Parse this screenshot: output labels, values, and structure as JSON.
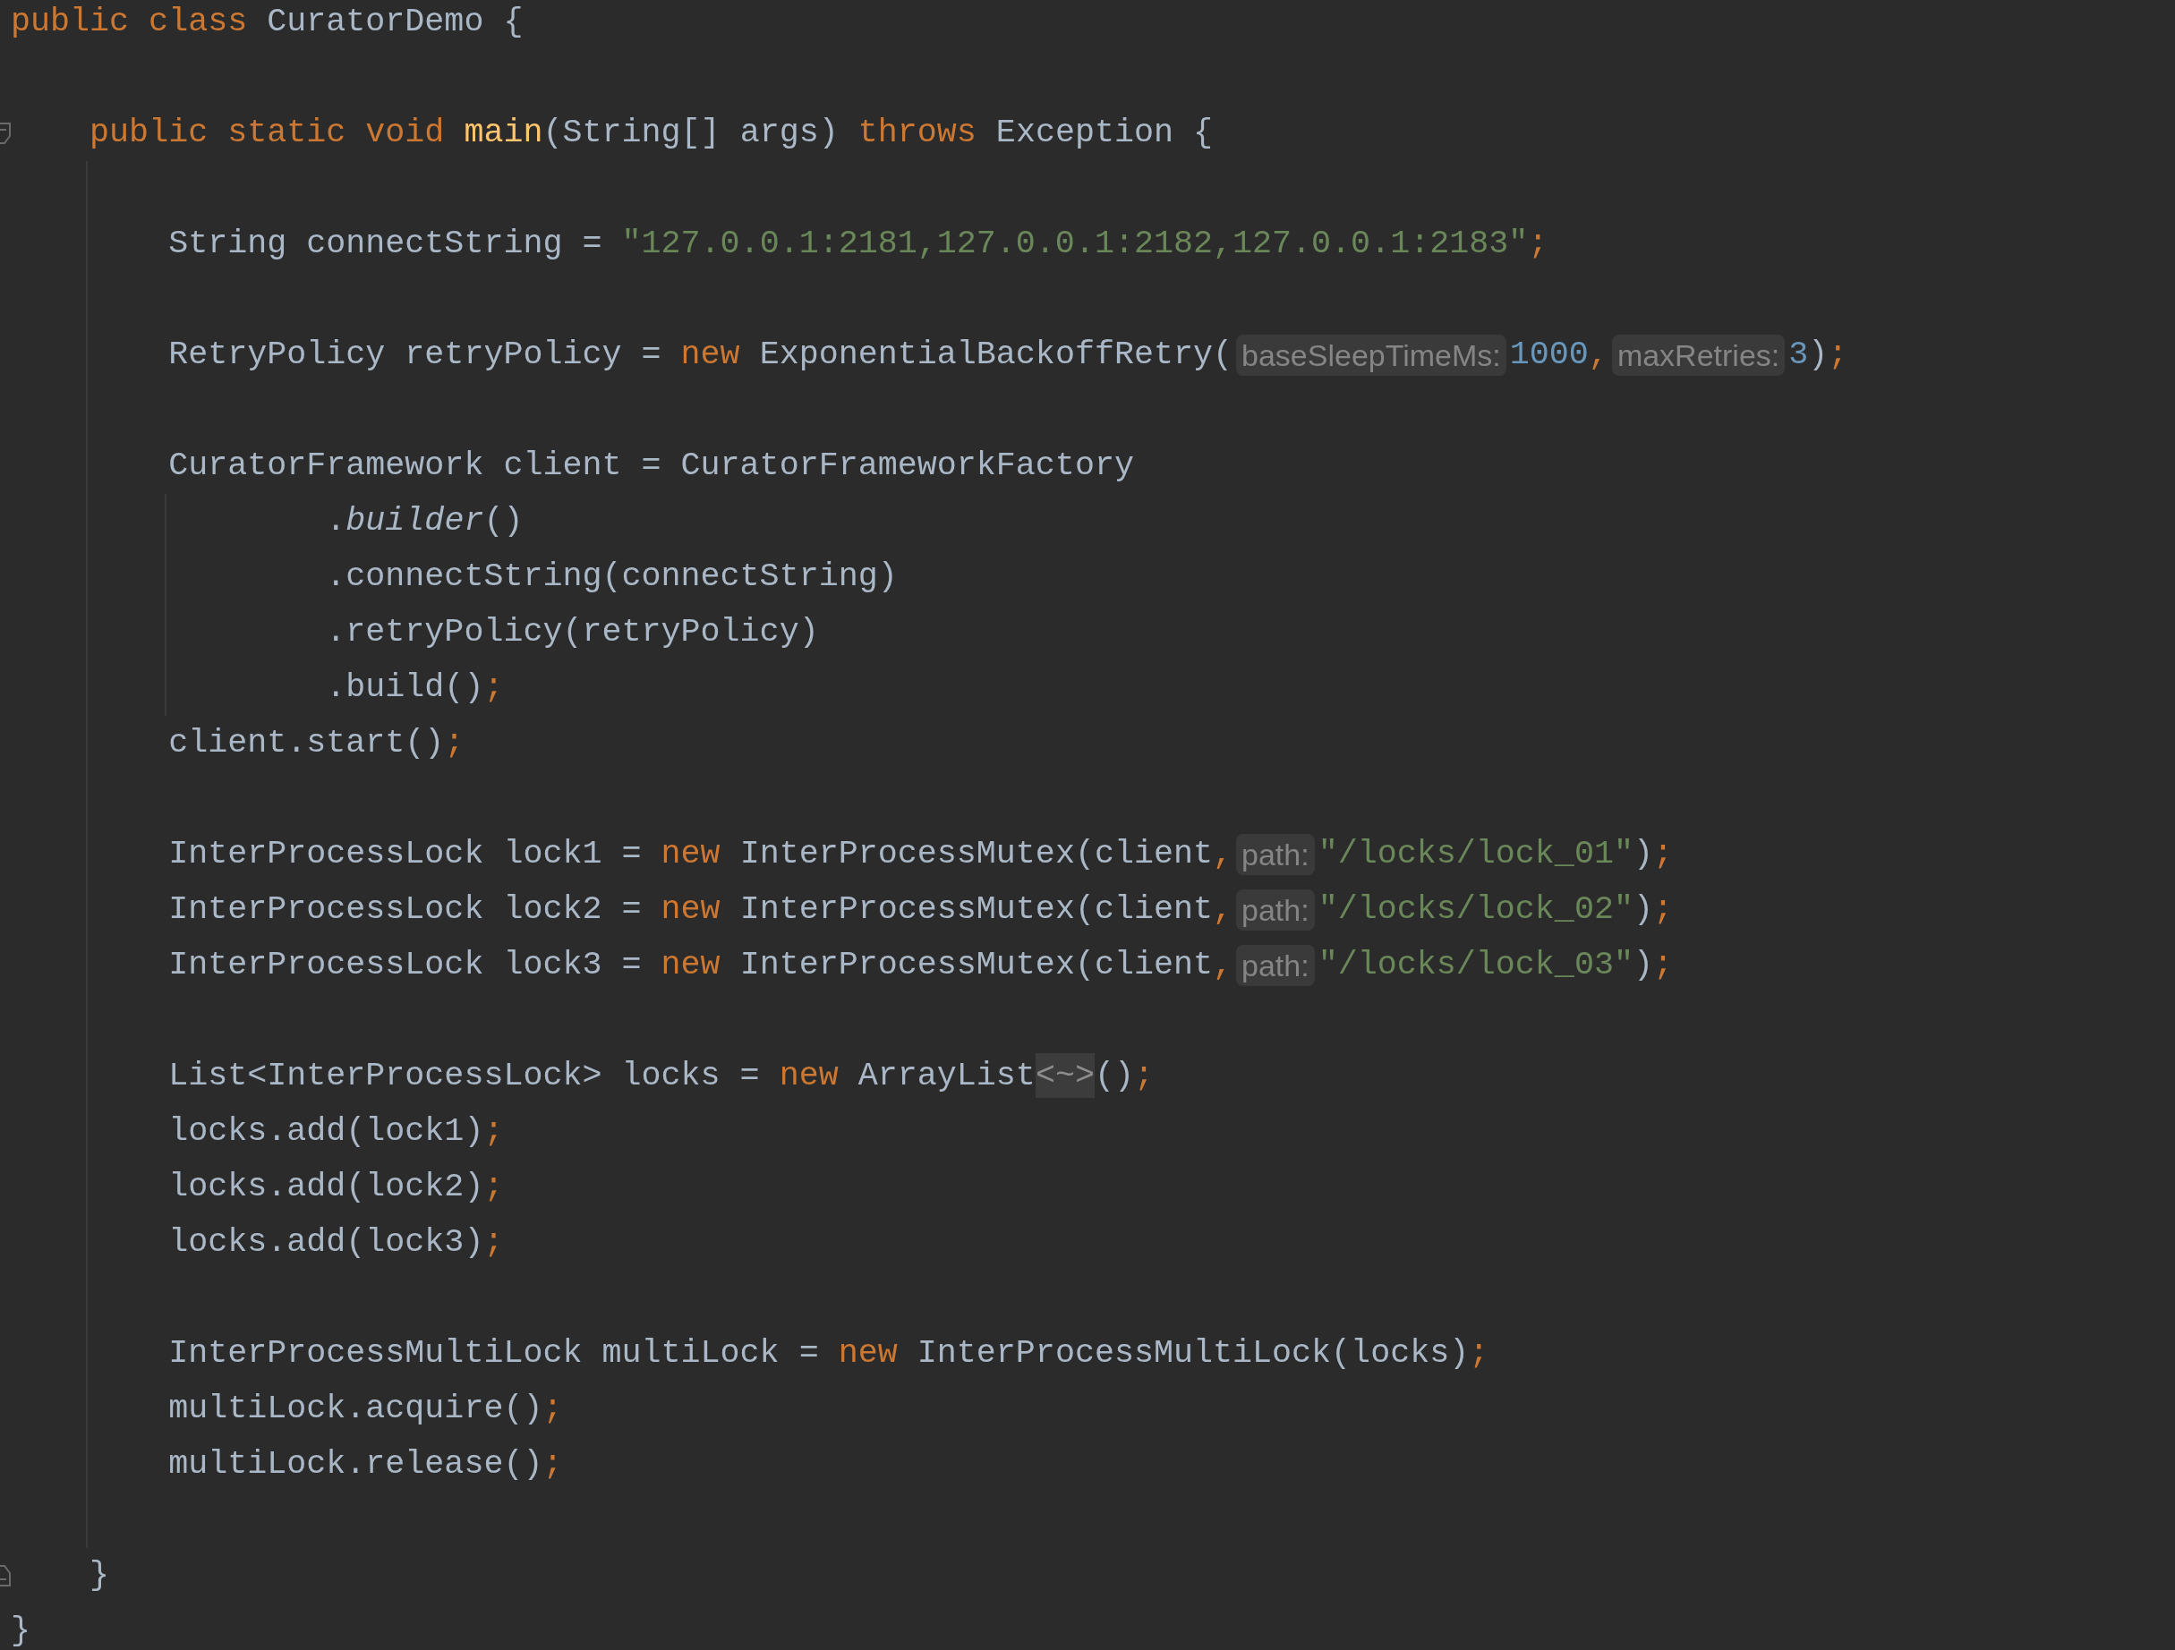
{
  "editor": {
    "lines": [
      {
        "kind": "code",
        "segments": [
          {
            "kind": "code",
            "tokens": [
              {
                "kind": "keyword",
                "text": "public class"
              },
              {
                "kind": "plain",
                "text": " CuratorDemo {"
              }
            ]
          }
        ]
      },
      {
        "kind": "blank"
      },
      {
        "kind": "code",
        "fold_marker": {
          "kind": "start",
          "expanded": true
        },
        "segments": [
          {
            "kind": "code",
            "tokens": [
              {
                "kind": "keyword",
                "text": "    public static void "
              },
              {
                "kind": "method",
                "text": "main"
              },
              {
                "kind": "plain",
                "text": "(String[] args) "
              },
              {
                "kind": "keyword",
                "text": "throws"
              },
              {
                "kind": "plain",
                "text": " Exception {"
              }
            ]
          }
        ]
      },
      {
        "kind": "blank"
      },
      {
        "kind": "code",
        "segments": [
          {
            "kind": "code",
            "tokens": [
              {
                "kind": "plain",
                "text": "        String connectString = "
              },
              {
                "kind": "string",
                "text": "\"127.0.0.1:2181,127.0.0.1:2182,127.0.0.1:2183\""
              },
              {
                "kind": "punct",
                "text": ";"
              }
            ]
          }
        ]
      },
      {
        "kind": "blank"
      },
      {
        "kind": "code",
        "segments": [
          {
            "kind": "code",
            "tokens": [
              {
                "kind": "plain",
                "text": "        RetryPolicy retryPolicy = "
              },
              {
                "kind": "keyword",
                "text": "new"
              },
              {
                "kind": "plain",
                "text": " ExponentialBackoffRetry("
              }
            ]
          },
          {
            "kind": "hint",
            "text": "baseSleepTimeMs:"
          },
          {
            "kind": "code",
            "tokens": [
              {
                "kind": "number",
                "text": "1000"
              },
              {
                "kind": "punct",
                "text": ","
              }
            ]
          },
          {
            "kind": "hint",
            "text": "maxRetries:"
          },
          {
            "kind": "code",
            "tokens": [
              {
                "kind": "number",
                "text": "3"
              },
              {
                "kind": "plain",
                "text": ")"
              },
              {
                "kind": "punct",
                "text": ";"
              }
            ]
          }
        ]
      },
      {
        "kind": "blank"
      },
      {
        "kind": "code",
        "segments": [
          {
            "kind": "code",
            "tokens": [
              {
                "kind": "plain",
                "text": "        CuratorFramework client = CuratorFrameworkFactory"
              }
            ]
          }
        ]
      },
      {
        "kind": "code",
        "segments": [
          {
            "kind": "code",
            "tokens": [
              {
                "kind": "plain",
                "text": "                ."
              },
              {
                "kind": "static",
                "text": "builder"
              },
              {
                "kind": "plain",
                "text": "()"
              }
            ]
          }
        ]
      },
      {
        "kind": "code",
        "segments": [
          {
            "kind": "code",
            "tokens": [
              {
                "kind": "plain",
                "text": "                .connectString(connectString)"
              }
            ]
          }
        ]
      },
      {
        "kind": "code",
        "segments": [
          {
            "kind": "code",
            "tokens": [
              {
                "kind": "plain",
                "text": "                .retryPolicy(retryPolicy)"
              }
            ]
          }
        ]
      },
      {
        "kind": "code",
        "segments": [
          {
            "kind": "code",
            "tokens": [
              {
                "kind": "plain",
                "text": "                .build()"
              },
              {
                "kind": "punct",
                "text": ";"
              }
            ]
          }
        ]
      },
      {
        "kind": "code",
        "segments": [
          {
            "kind": "code",
            "tokens": [
              {
                "kind": "plain",
                "text": "        client.start()"
              },
              {
                "kind": "punct",
                "text": ";"
              }
            ]
          }
        ]
      },
      {
        "kind": "blank"
      },
      {
        "kind": "code",
        "segments": [
          {
            "kind": "code",
            "tokens": [
              {
                "kind": "plain",
                "text": "        InterProcessLock lock1 = "
              },
              {
                "kind": "keyword",
                "text": "new"
              },
              {
                "kind": "plain",
                "text": " InterProcessMutex(client"
              },
              {
                "kind": "punct",
                "text": ","
              }
            ]
          },
          {
            "kind": "hint",
            "text": "path:"
          },
          {
            "kind": "code",
            "tokens": [
              {
                "kind": "string",
                "text": "\"/locks/lock_01\""
              },
              {
                "kind": "plain",
                "text": ")"
              },
              {
                "kind": "punct",
                "text": ";"
              }
            ]
          }
        ]
      },
      {
        "kind": "code",
        "segments": [
          {
            "kind": "code",
            "tokens": [
              {
                "kind": "plain",
                "text": "        InterProcessLock lock2 = "
              },
              {
                "kind": "keyword",
                "text": "new"
              },
              {
                "kind": "plain",
                "text": " InterProcessMutex(client"
              },
              {
                "kind": "punct",
                "text": ","
              }
            ]
          },
          {
            "kind": "hint",
            "text": "path:"
          },
          {
            "kind": "code",
            "tokens": [
              {
                "kind": "string",
                "text": "\"/locks/lock_02\""
              },
              {
                "kind": "plain",
                "text": ")"
              },
              {
                "kind": "punct",
                "text": ";"
              }
            ]
          }
        ]
      },
      {
        "kind": "code",
        "segments": [
          {
            "kind": "code",
            "tokens": [
              {
                "kind": "plain",
                "text": "        InterProcessLock lock3 = "
              },
              {
                "kind": "keyword",
                "text": "new"
              },
              {
                "kind": "plain",
                "text": " InterProcessMutex(client"
              },
              {
                "kind": "punct",
                "text": ","
              }
            ]
          },
          {
            "kind": "hint",
            "text": "path:"
          },
          {
            "kind": "code",
            "tokens": [
              {
                "kind": "string",
                "text": "\"/locks/lock_03\""
              },
              {
                "kind": "plain",
                "text": ")"
              },
              {
                "kind": "punct",
                "text": ";"
              }
            ]
          }
        ]
      },
      {
        "kind": "blank"
      },
      {
        "kind": "code",
        "segments": [
          {
            "kind": "code",
            "tokens": [
              {
                "kind": "plain",
                "text": "        List<InterProcessLock> locks = "
              },
              {
                "kind": "keyword",
                "text": "new"
              },
              {
                "kind": "plain",
                "text": " ArrayList"
              },
              {
                "kind": "folded",
                "text": "<~>"
              },
              {
                "kind": "plain",
                "text": "()"
              },
              {
                "kind": "punct",
                "text": ";"
              }
            ]
          }
        ]
      },
      {
        "kind": "code",
        "segments": [
          {
            "kind": "code",
            "tokens": [
              {
                "kind": "plain",
                "text": "        locks.add(lock1)"
              },
              {
                "kind": "punct",
                "text": ";"
              }
            ]
          }
        ]
      },
      {
        "kind": "code",
        "segments": [
          {
            "kind": "code",
            "tokens": [
              {
                "kind": "plain",
                "text": "        locks.add(lock2)"
              },
              {
                "kind": "punct",
                "text": ";"
              }
            ]
          }
        ]
      },
      {
        "kind": "code",
        "segments": [
          {
            "kind": "code",
            "tokens": [
              {
                "kind": "plain",
                "text": "        locks.add(lock3)"
              },
              {
                "kind": "punct",
                "text": ";"
              }
            ]
          }
        ]
      },
      {
        "kind": "blank"
      },
      {
        "kind": "code",
        "segments": [
          {
            "kind": "code",
            "tokens": [
              {
                "kind": "plain",
                "text": "        InterProcessMultiLock multiLock = "
              },
              {
                "kind": "keyword",
                "text": "new"
              },
              {
                "kind": "plain",
                "text": " InterProcessMultiLock(locks)"
              },
              {
                "kind": "punct",
                "text": ";"
              }
            ]
          }
        ]
      },
      {
        "kind": "code",
        "segments": [
          {
            "kind": "code",
            "tokens": [
              {
                "kind": "plain",
                "text": "        multiLock.acquire()"
              },
              {
                "kind": "punct",
                "text": ";"
              }
            ]
          }
        ]
      },
      {
        "kind": "code",
        "segments": [
          {
            "kind": "code",
            "tokens": [
              {
                "kind": "plain",
                "text": "        multiLock.release()"
              },
              {
                "kind": "punct",
                "text": ";"
              }
            ]
          }
        ]
      },
      {
        "kind": "blank"
      },
      {
        "kind": "code",
        "fold_marker": {
          "kind": "end",
          "expanded": true
        },
        "segments": [
          {
            "kind": "code",
            "tokens": [
              {
                "kind": "plain",
                "text": "    }"
              }
            ]
          }
        ]
      },
      {
        "kind": "code",
        "segments": [
          {
            "kind": "code",
            "tokens": [
              {
                "kind": "plain",
                "text": "}"
              }
            ]
          }
        ]
      }
    ]
  }
}
